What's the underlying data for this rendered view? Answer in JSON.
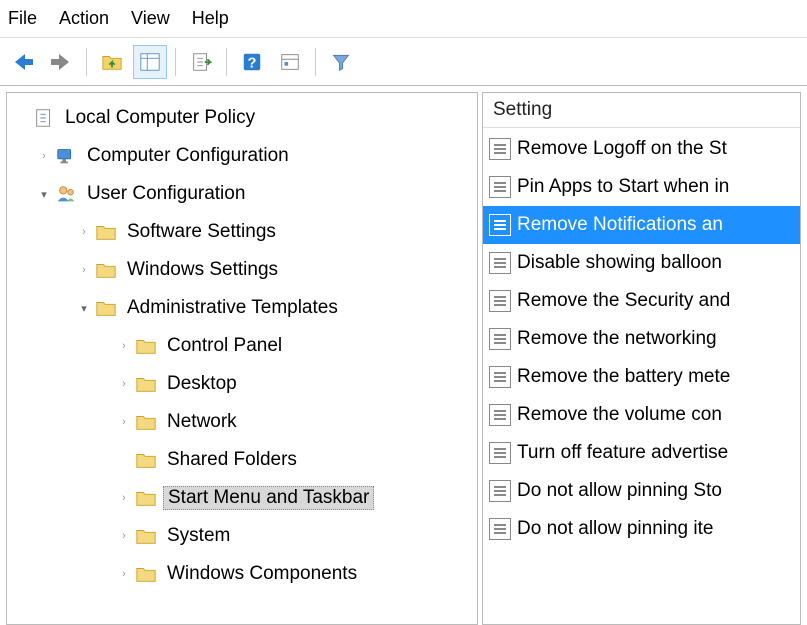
{
  "menubar": [
    "File",
    "Action",
    "View",
    "Help"
  ],
  "tree": {
    "root_label": "Local Computer Policy",
    "nodes": [
      {
        "indent": 0,
        "expander": "closed",
        "icon": "computer-config",
        "label": "Computer Configuration",
        "selected": false
      },
      {
        "indent": 0,
        "expander": "open",
        "icon": "user-config",
        "label": "User Configuration",
        "selected": false
      },
      {
        "indent": 1,
        "expander": "closed",
        "icon": "folder",
        "label": "Software Settings",
        "selected": false
      },
      {
        "indent": 1,
        "expander": "closed",
        "icon": "folder",
        "label": "Windows Settings",
        "selected": false
      },
      {
        "indent": 1,
        "expander": "open",
        "icon": "folder",
        "label": "Administrative Templates",
        "selected": false
      },
      {
        "indent": 2,
        "expander": "closed",
        "icon": "folder",
        "label": "Control Panel",
        "selected": false
      },
      {
        "indent": 2,
        "expander": "closed",
        "icon": "folder",
        "label": "Desktop",
        "selected": false
      },
      {
        "indent": 2,
        "expander": "closed",
        "icon": "folder",
        "label": "Network",
        "selected": false
      },
      {
        "indent": 2,
        "expander": "none",
        "icon": "folder",
        "label": "Shared Folders",
        "selected": false
      },
      {
        "indent": 2,
        "expander": "closed",
        "icon": "folder",
        "label": "Start Menu and Taskbar",
        "selected": true
      },
      {
        "indent": 2,
        "expander": "closed",
        "icon": "folder",
        "label": "System",
        "selected": false
      },
      {
        "indent": 2,
        "expander": "closed",
        "icon": "folder",
        "label": "Windows Components",
        "selected": false
      }
    ]
  },
  "list": {
    "header": "Setting",
    "items": [
      {
        "label": "Remove Logoff on the St",
        "selected": false
      },
      {
        "label": "Pin Apps to Start when in",
        "selected": false
      },
      {
        "label": "Remove Notifications an",
        "selected": true
      },
      {
        "label": "Disable showing balloon",
        "selected": false
      },
      {
        "label": "Remove the Security and",
        "selected": false
      },
      {
        "label": "Remove the networking",
        "selected": false
      },
      {
        "label": "Remove the battery mete",
        "selected": false
      },
      {
        "label": "Remove the volume con",
        "selected": false
      },
      {
        "label": "Turn off feature advertise",
        "selected": false
      },
      {
        "label": "Do not allow pinning Sto",
        "selected": false
      },
      {
        "label": "Do not allow pinning ite",
        "selected": false
      }
    ]
  }
}
